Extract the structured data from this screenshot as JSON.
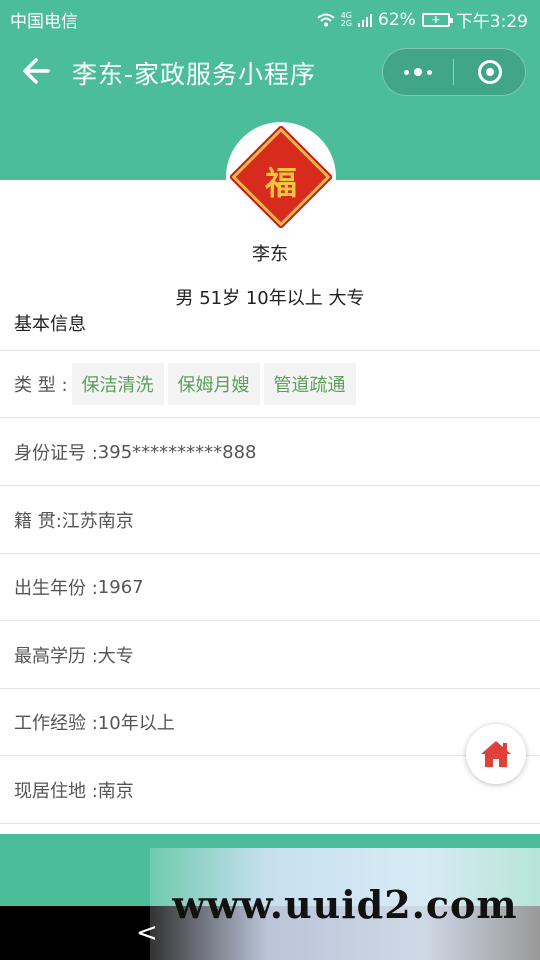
{
  "status_bar": {
    "carrier": "中国电信",
    "network": [
      "4G",
      "2G"
    ],
    "battery": "62%",
    "time": "下午3:29"
  },
  "header": {
    "title": "李东-家政服务小程序",
    "back_icon": "arrow-left-icon",
    "menu_icon": "more-dots-icon",
    "close_icon": "target-circle-icon"
  },
  "profile": {
    "avatar_glyph": "福",
    "name": "李东",
    "summary": "男 51岁 10年以上 大专"
  },
  "section": {
    "title": "基本信息"
  },
  "type_row": {
    "label": "类 型 :",
    "tags": [
      "保洁清洗",
      "保姆月嫂",
      "管道疏通"
    ]
  },
  "rows": [
    {
      "label": "身份证号 : ",
      "value": "395**********888"
    },
    {
      "label": "籍 贯: ",
      "value": "江苏南京"
    },
    {
      "label": "出生年份 : ",
      "value": "1967"
    },
    {
      "label": "最高学历 : ",
      "value": "大专"
    },
    {
      "label": "工作经验 : ",
      "value": "10年以上"
    },
    {
      "label": "现居住地 : ",
      "value": "南京"
    }
  ],
  "floating": {
    "home_icon": "home-icon"
  },
  "nav": {
    "back_glyph": "<"
  },
  "watermark": "www.uuid2.com",
  "colors": {
    "brand": "#4bbd98",
    "tag_text": "#5aa05a",
    "home_icon": "#e0403a"
  }
}
